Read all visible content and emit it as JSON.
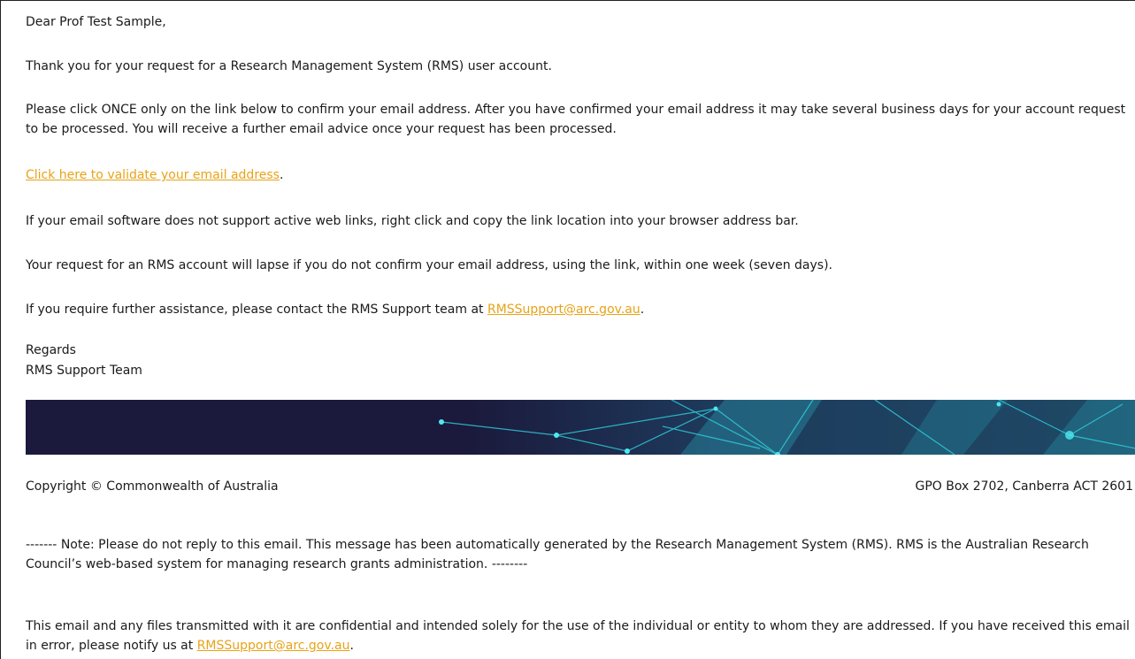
{
  "email": {
    "greeting": "Dear Prof Test Sample,",
    "thanks": "Thank you for your request for a Research Management System (RMS) user account.",
    "instructions": "Please click ONCE only on the link below to confirm your email address. After you have confirmed your email address it may take several business days for your account request to be processed. You will receive a further email advice once your request has been processed.",
    "validate_link": "Click here to validate your email address",
    "validate_suffix": ".",
    "copy_tip": "If your email software does not support active web links, right click and copy the link location into your browser address bar.",
    "lapse_warning": "Your request for an RMS account will lapse if you do not confirm your email address, using the link, within one week (seven days).",
    "assistance_prefix": "If you require further assistance, please contact the RMS Support team at ",
    "assistance_email": "RMSSupport@arc.gov.au",
    "assistance_suffix": ".",
    "signoff": "Regards",
    "signature": "RMS Support Team"
  },
  "footer": {
    "copyright": "Copyright © Commonwealth of Australia",
    "address": "GPO Box 2702, Canberra ACT 2601",
    "note": "------- Note: Please do not reply to this email. This message has been automatically generated by the Research Management System (RMS). RMS is the Australian Research Council’s web-based system for managing research grants administration. --------",
    "confidentiality_prefix": "This email and any files transmitted with it are confidential and intended solely for the use of the individual or entity to whom they are addressed. If you have received this email in error, please notify us at ",
    "confidentiality_email": "RMSSupport@arc.gov.au",
    "confidentiality_suffix": "."
  },
  "colors": {
    "link": "#e8a317",
    "banner_bg": "#1b1a3c",
    "banner_accent": "#2fd3e0"
  }
}
